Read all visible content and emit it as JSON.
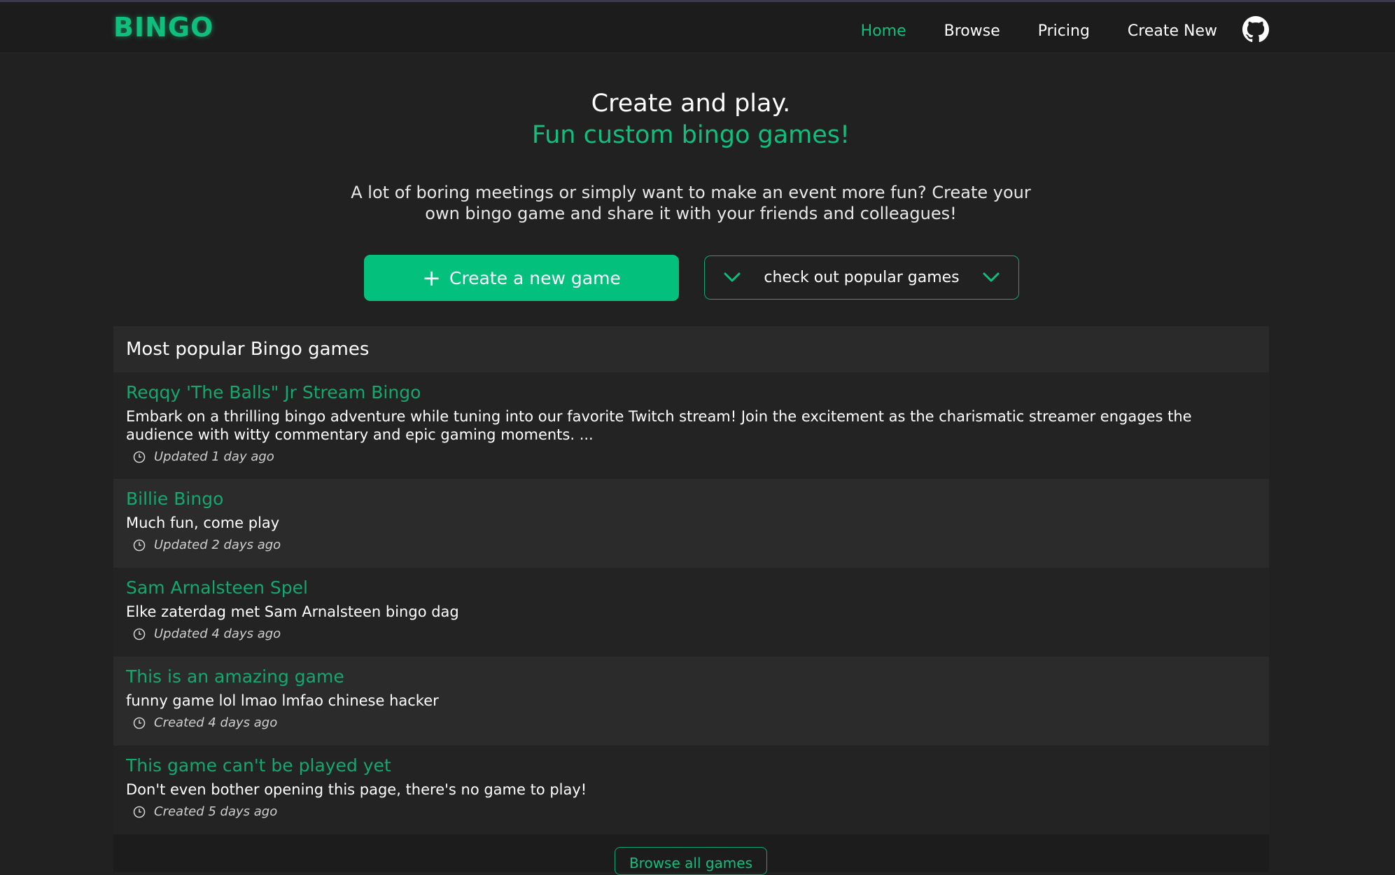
{
  "header": {
    "logo": "BINGO",
    "nav": [
      {
        "label": "Home",
        "active": true
      },
      {
        "label": "Browse",
        "active": false
      },
      {
        "label": "Pricing",
        "active": false
      },
      {
        "label": "Create New",
        "active": false
      }
    ],
    "github_icon": "github-icon"
  },
  "hero": {
    "title": "Create and play.",
    "subtitle": "Fun custom bingo games!",
    "description": "A lot of boring meetings or simply want to make an event more fun? Create your own bingo game and share it with your friends and colleagues!",
    "create_button": "Create a new game",
    "popular_button": "check out popular games"
  },
  "popular": {
    "heading": "Most popular Bingo games",
    "items": [
      {
        "title": "Reqqy 'The Balls\" Jr Stream Bingo",
        "description": "Embark on a thrilling bingo adventure while tuning into our favorite Twitch stream! Join the excitement as the charismatic streamer engages the audience with witty commentary and epic gaming moments. ...",
        "meta": "Updated 1 day ago"
      },
      {
        "title": "Billie Bingo",
        "description": "Much fun, come play",
        "meta": "Updated 2 days ago"
      },
      {
        "title": "Sam Arnalsteen Spel",
        "description": "Elke zaterdag met Sam Arnalsteen bingo dag",
        "meta": "Updated 4 days ago"
      },
      {
        "title": "This is an amazing game",
        "description": "funny game lol lmao lmfao chinese hacker",
        "meta": "Created 4 days ago"
      },
      {
        "title": "This game can't be played yet",
        "description": "Don't even bother opening this page, there's no game to play!",
        "meta": "Created 5 days ago"
      }
    ],
    "browse_all": "Browse all games"
  },
  "colors": {
    "accent": "#0fbf7d",
    "background": "#212121",
    "button": "#03c07d"
  }
}
